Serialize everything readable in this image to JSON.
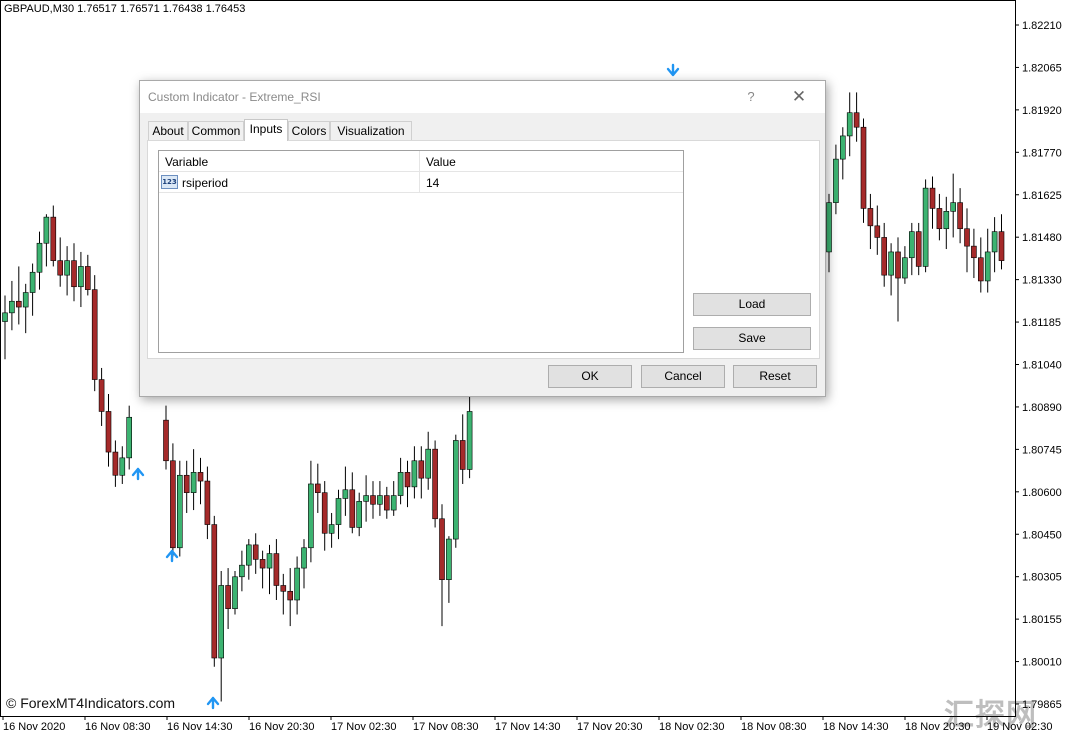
{
  "chart": {
    "header": "GBPAUD,M30  1.76517 1.76571 1.76438 1.76453",
    "watermark": "© ForexMT4Indicators.com",
    "corner_mark": "汇探网",
    "price_labels": [
      "1.82210",
      "1.82065",
      "1.81920",
      "1.81770",
      "1.81625",
      "1.81480",
      "1.81330",
      "1.81185",
      "1.81040",
      "1.80890",
      "1.80745",
      "1.80600",
      "1.80450",
      "1.80305",
      "1.80155",
      "1.80010",
      "1.79865"
    ],
    "time_labels": [
      "16 Nov 2020",
      "16 Nov 08:30",
      "16 Nov 14:30",
      "16 Nov 20:30",
      "17 Nov 02:30",
      "17 Nov 08:30",
      "17 Nov 14:30",
      "17 Nov 20:30",
      "18 Nov 02:30",
      "18 Nov 08:30",
      "18 Nov 14:30",
      "18 Nov 20:30",
      "19 Nov 02:30"
    ],
    "colors": {
      "bull": "#3cb371",
      "bear": "#a52a2a",
      "arrow": "#2196f3",
      "axis": "#000000"
    },
    "ylim": [
      1.7985,
      1.8226
    ]
  },
  "chart_data": {
    "type": "candlestick",
    "ylim": [
      1.7985,
      1.8226
    ],
    "candles_visible_left": [
      {
        "o": 1.8121,
        "h": 1.813,
        "l": 1.8108,
        "c": 1.8124
      },
      {
        "o": 1.8124,
        "h": 1.8135,
        "l": 1.8118,
        "c": 1.8128
      },
      {
        "o": 1.8128,
        "h": 1.814,
        "l": 1.812,
        "c": 1.8126
      },
      {
        "o": 1.8126,
        "h": 1.8134,
        "l": 1.8117,
        "c": 1.8131
      },
      {
        "o": 1.8131,
        "h": 1.8141,
        "l": 1.8123,
        "c": 1.8138
      },
      {
        "o": 1.8138,
        "h": 1.8152,
        "l": 1.8132,
        "c": 1.8148
      },
      {
        "o": 1.8148,
        "h": 1.8158,
        "l": 1.814,
        "c": 1.8157
      },
      {
        "o": 1.8157,
        "h": 1.8161,
        "l": 1.814,
        "c": 1.8142
      },
      {
        "o": 1.8142,
        "h": 1.815,
        "l": 1.8133,
        "c": 1.8137
      },
      {
        "o": 1.8137,
        "h": 1.8147,
        "l": 1.813,
        "c": 1.8142
      },
      {
        "o": 1.8142,
        "h": 1.8148,
        "l": 1.8128,
        "c": 1.8133
      },
      {
        "o": 1.8133,
        "h": 1.8145,
        "l": 1.8126,
        "c": 1.814
      },
      {
        "o": 1.814,
        "h": 1.8144,
        "l": 1.813,
        "c": 1.8132
      },
      {
        "o": 1.8132,
        "h": 1.8137,
        "l": 1.8097,
        "c": 1.8101
      },
      {
        "o": 1.8101,
        "h": 1.8105,
        "l": 1.8085,
        "c": 1.809
      },
      {
        "o": 1.809,
        "h": 1.8096,
        "l": 1.8071,
        "c": 1.8076
      },
      {
        "o": 1.8076,
        "h": 1.808,
        "l": 1.8064,
        "c": 1.8068
      },
      {
        "o": 1.8068,
        "h": 1.8078,
        "l": 1.8065,
        "c": 1.8074
      },
      {
        "o": 1.8074,
        "h": 1.8092,
        "l": 1.807,
        "c": 1.8088
      }
    ],
    "candles_visible_middle": [
      {
        "o": 1.8087,
        "h": 1.8092,
        "l": 1.807,
        "c": 1.8073
      },
      {
        "o": 1.8073,
        "h": 1.8079,
        "l": 1.804,
        "c": 1.8043
      },
      {
        "o": 1.8043,
        "h": 1.8073,
        "l": 1.804,
        "c": 1.8068
      },
      {
        "o": 1.8068,
        "h": 1.8073,
        "l": 1.8055,
        "c": 1.8062
      },
      {
        "o": 1.8062,
        "h": 1.8077,
        "l": 1.8056,
        "c": 1.8069
      },
      {
        "o": 1.8069,
        "h": 1.8074,
        "l": 1.8058,
        "c": 1.8066
      },
      {
        "o": 1.8066,
        "h": 1.8071,
        "l": 1.8046,
        "c": 1.8051
      },
      {
        "o": 1.8051,
        "h": 1.8054,
        "l": 1.8002,
        "c": 1.8005
      },
      {
        "o": 1.8005,
        "h": 1.8035,
        "l": 1.799,
        "c": 1.803
      },
      {
        "o": 1.803,
        "h": 1.8036,
        "l": 1.8015,
        "c": 1.8022
      },
      {
        "o": 1.8022,
        "h": 1.8035,
        "l": 1.802,
        "c": 1.8033
      },
      {
        "o": 1.8033,
        "h": 1.8042,
        "l": 1.8028,
        "c": 1.8037
      },
      {
        "o": 1.8037,
        "h": 1.8046,
        "l": 1.8032,
        "c": 1.8044
      },
      {
        "o": 1.8044,
        "h": 1.8048,
        "l": 1.8034,
        "c": 1.8039
      },
      {
        "o": 1.8039,
        "h": 1.8042,
        "l": 1.8029,
        "c": 1.8036
      },
      {
        "o": 1.8036,
        "h": 1.8044,
        "l": 1.8027,
        "c": 1.8041
      },
      {
        "o": 1.8041,
        "h": 1.8046,
        "l": 1.8025,
        "c": 1.803
      },
      {
        "o": 1.803,
        "h": 1.8034,
        "l": 1.802,
        "c": 1.8028
      },
      {
        "o": 1.8028,
        "h": 1.8036,
        "l": 1.8016,
        "c": 1.8025
      },
      {
        "o": 1.8025,
        "h": 1.804,
        "l": 1.802,
        "c": 1.8036
      },
      {
        "o": 1.8036,
        "h": 1.8046,
        "l": 1.8029,
        "c": 1.8043
      },
      {
        "o": 1.8043,
        "h": 1.8073,
        "l": 1.8038,
        "c": 1.8065
      },
      {
        "o": 1.8065,
        "h": 1.8072,
        "l": 1.8055,
        "c": 1.8062
      },
      {
        "o": 1.8062,
        "h": 1.8066,
        "l": 1.8042,
        "c": 1.8048
      },
      {
        "o": 1.8048,
        "h": 1.8055,
        "l": 1.8043,
        "c": 1.8051
      },
      {
        "o": 1.8051,
        "h": 1.8063,
        "l": 1.8046,
        "c": 1.806
      },
      {
        "o": 1.806,
        "h": 1.8071,
        "l": 1.8054,
        "c": 1.8063
      },
      {
        "o": 1.8063,
        "h": 1.8069,
        "l": 1.8048,
        "c": 1.805
      },
      {
        "o": 1.805,
        "h": 1.8062,
        "l": 1.8047,
        "c": 1.8059
      },
      {
        "o": 1.8059,
        "h": 1.8068,
        "l": 1.8052,
        "c": 1.8061
      },
      {
        "o": 1.8061,
        "h": 1.8066,
        "l": 1.8053,
        "c": 1.8058
      },
      {
        "o": 1.8058,
        "h": 1.8066,
        "l": 1.8054,
        "c": 1.8061
      },
      {
        "o": 1.8061,
        "h": 1.8064,
        "l": 1.8053,
        "c": 1.8056
      },
      {
        "o": 1.8056,
        "h": 1.8066,
        "l": 1.8054,
        "c": 1.8061
      },
      {
        "o": 1.8061,
        "h": 1.8074,
        "l": 1.8058,
        "c": 1.8069
      },
      {
        "o": 1.8069,
        "h": 1.8073,
        "l": 1.8057,
        "c": 1.8064
      },
      {
        "o": 1.8064,
        "h": 1.8078,
        "l": 1.806,
        "c": 1.8073
      },
      {
        "o": 1.8073,
        "h": 1.8078,
        "l": 1.806,
        "c": 1.8067
      },
      {
        "o": 1.8067,
        "h": 1.8083,
        "l": 1.8063,
        "c": 1.8077
      },
      {
        "o": 1.8077,
        "h": 1.808,
        "l": 1.805,
        "c": 1.8053
      },
      {
        "o": 1.8053,
        "h": 1.8058,
        "l": 1.8016,
        "c": 1.8032
      },
      {
        "o": 1.8032,
        "h": 1.8047,
        "l": 1.8024,
        "c": 1.8046
      },
      {
        "o": 1.8046,
        "h": 1.8082,
        "l": 1.8043,
        "c": 1.808
      },
      {
        "o": 1.808,
        "h": 1.8089,
        "l": 1.8065,
        "c": 1.807
      },
      {
        "o": 1.807,
        "h": 1.8095,
        "l": 1.8067,
        "c": 1.809
      }
    ],
    "candles_visible_right": [
      {
        "o": 1.8145,
        "h": 1.8165,
        "l": 1.8138,
        "c": 1.8162
      },
      {
        "o": 1.8162,
        "h": 1.8182,
        "l": 1.8158,
        "c": 1.8177
      },
      {
        "o": 1.8177,
        "h": 1.8188,
        "l": 1.817,
        "c": 1.8185
      },
      {
        "o": 1.8185,
        "h": 1.82,
        "l": 1.8178,
        "c": 1.8193
      },
      {
        "o": 1.8193,
        "h": 1.82,
        "l": 1.8183,
        "c": 1.8188
      },
      {
        "o": 1.8188,
        "h": 1.8191,
        "l": 1.8155,
        "c": 1.816
      },
      {
        "o": 1.816,
        "h": 1.8165,
        "l": 1.8146,
        "c": 1.8154
      },
      {
        "o": 1.8154,
        "h": 1.8161,
        "l": 1.8144,
        "c": 1.815
      },
      {
        "o": 1.815,
        "h": 1.8155,
        "l": 1.8133,
        "c": 1.8137
      },
      {
        "o": 1.8137,
        "h": 1.8148,
        "l": 1.813,
        "c": 1.8145
      },
      {
        "o": 1.8145,
        "h": 1.815,
        "l": 1.8121,
        "c": 1.8136
      },
      {
        "o": 1.8136,
        "h": 1.8147,
        "l": 1.8134,
        "c": 1.8143
      },
      {
        "o": 1.8143,
        "h": 1.8155,
        "l": 1.8137,
        "c": 1.8152
      },
      {
        "o": 1.8152,
        "h": 1.8155,
        "l": 1.8137,
        "c": 1.814
      },
      {
        "o": 1.814,
        "h": 1.817,
        "l": 1.8138,
        "c": 1.8167
      },
      {
        "o": 1.8167,
        "h": 1.8171,
        "l": 1.8153,
        "c": 1.816
      },
      {
        "o": 1.816,
        "h": 1.8165,
        "l": 1.8149,
        "c": 1.8153
      },
      {
        "o": 1.8153,
        "h": 1.8164,
        "l": 1.8146,
        "c": 1.8159
      },
      {
        "o": 1.8159,
        "h": 1.8172,
        "l": 1.815,
        "c": 1.8162
      },
      {
        "o": 1.8162,
        "h": 1.8167,
        "l": 1.8148,
        "c": 1.8153
      },
      {
        "o": 1.8153,
        "h": 1.816,
        "l": 1.8138,
        "c": 1.8147
      },
      {
        "o": 1.8147,
        "h": 1.8153,
        "l": 1.8136,
        "c": 1.8143
      },
      {
        "o": 1.8143,
        "h": 1.815,
        "l": 1.8131,
        "c": 1.8135
      },
      {
        "o": 1.8135,
        "h": 1.8153,
        "l": 1.8131,
        "c": 1.8145
      },
      {
        "o": 1.8145,
        "h": 1.8157,
        "l": 1.8138,
        "c": 1.8152
      },
      {
        "o": 1.8152,
        "h": 1.8158,
        "l": 1.8139,
        "c": 1.8142
      }
    ],
    "arrows_up_visible": 3,
    "arrows_down_visible": 1
  },
  "dialog": {
    "title": "Custom Indicator - Extreme_RSI",
    "help_label": "?",
    "close_label": "✕",
    "tabs": [
      {
        "label": "About"
      },
      {
        "label": "Common"
      },
      {
        "label": "Inputs"
      },
      {
        "label": "Colors"
      },
      {
        "label": "Visualization"
      }
    ],
    "active_tab": "Inputs",
    "grid": {
      "headers": {
        "variable": "Variable",
        "value": "Value"
      },
      "rows": [
        {
          "type_icon": "123",
          "variable": "rsiperiod",
          "value": "14"
        }
      ]
    },
    "buttons": {
      "load": "Load",
      "save": "Save",
      "ok": "OK",
      "cancel": "Cancel",
      "reset": "Reset"
    }
  }
}
